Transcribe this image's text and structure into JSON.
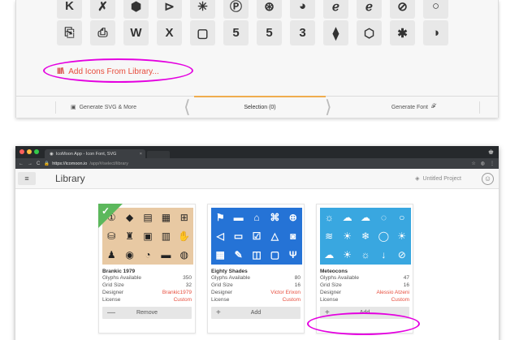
{
  "top_panel": {
    "row1_icons": [
      "K",
      "✗",
      "⬢",
      "⊳",
      "✳",
      "Ⓟ",
      "⊛",
      "◕",
      "ℯ",
      "ℯ",
      "⊘",
      "○"
    ],
    "row2_icons": [
      "⎘",
      "⎙",
      "W",
      "X",
      "▢",
      "5",
      "5",
      "3",
      "⧫",
      "⬡",
      "✱",
      "◑"
    ],
    "add_library_label": "Add Icons From Library...",
    "generate_svg_label": "Generate SVG & More",
    "selection_label": "Selection (0)",
    "generate_font_label": "Generate Font",
    "font_glyph": "𝓕"
  },
  "browser": {
    "tab_title": "IcoMoon App - Icon Font, SVG",
    "url_host": "https://icomoon.io",
    "url_path": "/app/#/select/library",
    "app_title": "Library",
    "project_name": "Untitled Project"
  },
  "cards": [
    {
      "name": "Brankic 1979",
      "glyphs_label": "Glyphs Available",
      "glyphs": "350",
      "grid_label": "Grid Size",
      "grid": "32",
      "designer_label": "Designer",
      "designer": "Brankic1979",
      "license_label": "License",
      "license": "Custom",
      "button": "Remove",
      "button_symbol": "—",
      "preview_icons": [
        "①",
        "◆",
        "▤",
        "▦",
        "⊞",
        "⛁",
        "♜",
        "▣",
        "▥",
        "✋",
        "♟",
        "◉",
        "◔",
        "▬",
        "◍"
      ]
    },
    {
      "name": "Eighty Shades",
      "glyphs_label": "Glyphs Available",
      "glyphs": "80",
      "grid_label": "Grid Size",
      "grid": "16",
      "designer_label": "Designer",
      "designer": "Victor Erixon",
      "license_label": "License",
      "license": "Custom",
      "button": "Add",
      "button_symbol": "+",
      "preview_icons": [
        "⚑",
        "▬",
        "⌂",
        "⌘",
        "⊕",
        "◁",
        "▭",
        "☑",
        "△",
        "◙",
        "▦",
        "✎",
        "◫",
        "▢",
        "Ψ"
      ]
    },
    {
      "name": "Meteocons",
      "glyphs_label": "Glyphs Available",
      "glyphs": "47",
      "grid_label": "Grid Size",
      "grid": "16",
      "designer_label": "Designer",
      "designer": "Alessio Atzeni",
      "license_label": "License",
      "license": "Custom",
      "button": "Add",
      "button_symbol": "+",
      "preview_icons": [
        "☼",
        "☁",
        "☁",
        "◌",
        "○",
        "≋",
        "☀",
        "❄",
        "◯",
        "☀",
        "☁",
        "☀",
        "☼",
        "↓",
        "⊘"
      ]
    }
  ],
  "colors": {
    "accent_red": "#e74c3c",
    "highlight_magenta": "#e400e0",
    "selected_green": "#5cb85c",
    "tab_underline": "#f0ad4e"
  }
}
